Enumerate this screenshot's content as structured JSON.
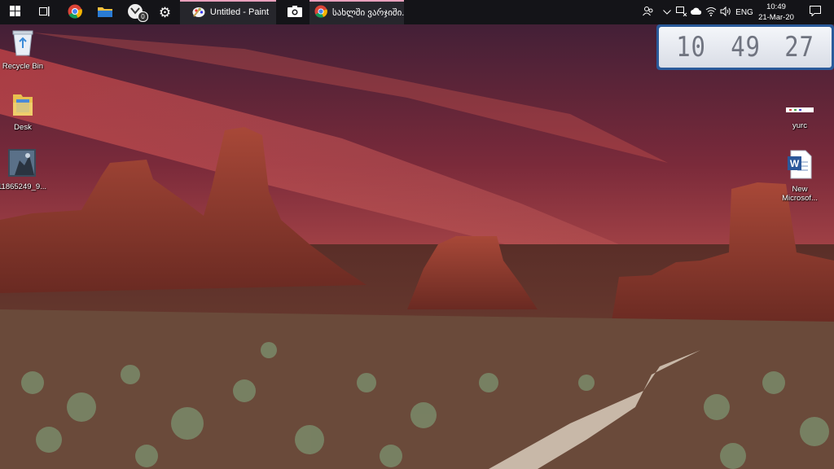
{
  "taskbar": {
    "apps": [
      {
        "label": "Untitled - Paint",
        "icon": "paint-icon",
        "active": true
      },
      {
        "label": "სახლში ვარჯიში...",
        "icon": "chrome-icon",
        "active": true
      }
    ],
    "badge_count": "0"
  },
  "tray": {
    "language": "ENG",
    "time": "10:49",
    "date": "21-Mar-20"
  },
  "desktop": {
    "icons": [
      {
        "label": "Recycle Bin",
        "icon": "recycle-bin-icon"
      },
      {
        "label": "Desk",
        "icon": "folder-icon"
      },
      {
        "label": "11865249_9...",
        "icon": "image-file-icon"
      },
      {
        "label": "yurc",
        "icon": "file-icon"
      },
      {
        "label": "New Microsof...",
        "icon": "word-document-icon"
      }
    ]
  },
  "clock_widget": {
    "hours": "10",
    "minutes": "49",
    "seconds": "27"
  }
}
